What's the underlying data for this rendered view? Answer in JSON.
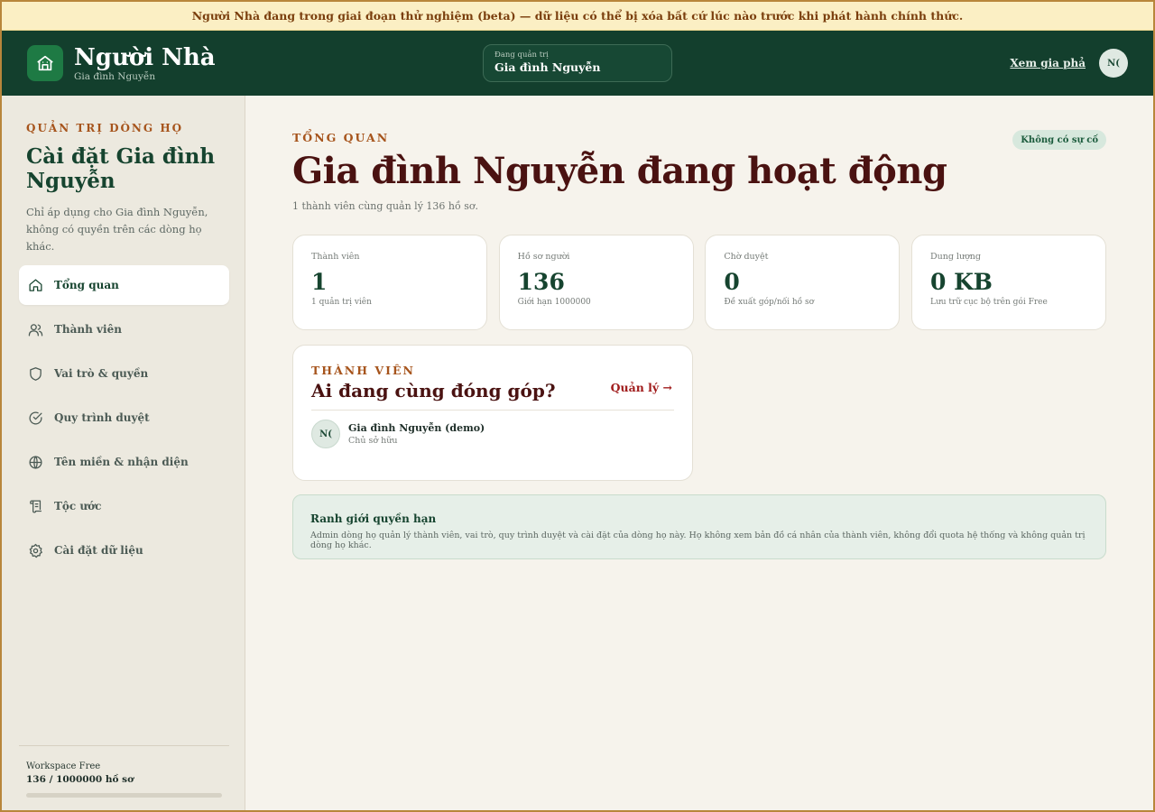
{
  "banner": "Người Nhà đang trong giai đoạn thử nghiệm (beta) — dữ liệu có thể bị xóa bất cứ lúc nào trước khi phát hành chính thức.",
  "header": {
    "brand": "Người Nhà",
    "brand_sub": "Gia đình Nguyễn",
    "workspace_label": "Đang quản trị",
    "workspace_value": "Gia đình Nguyễn",
    "view_tree_link": "Xem gia phả",
    "avatar_initials": "N("
  },
  "sidebar": {
    "eyebrow": "QUẢN TRỊ DÒNG HỌ",
    "title": "Cài đặt Gia đình Nguyễn",
    "description": "Chỉ áp dụng cho Gia đình Nguyễn, không có quyền trên các dòng họ khác.",
    "items": [
      {
        "label": "Tổng quan",
        "icon": "home-icon"
      },
      {
        "label": "Thành viên",
        "icon": "users-icon"
      },
      {
        "label": "Vai trò & quyền",
        "icon": "shield-icon"
      },
      {
        "label": "Quy trình duyệt",
        "icon": "check-circle-icon"
      },
      {
        "label": "Tên miền & nhận diện",
        "icon": "globe-icon"
      },
      {
        "label": "Tộc ước",
        "icon": "scroll-icon"
      },
      {
        "label": "Cài đặt dữ liệu",
        "icon": "gear-icon"
      }
    ],
    "footer": {
      "plan": "Workspace Free",
      "usage": "136 / 1000000 hồ sơ",
      "usage_fraction": 0.000136
    }
  },
  "main": {
    "eyebrow": "TỔNG QUAN",
    "status_badge": "Không có sự cố",
    "title": "Gia đình Nguyễn đang hoạt động",
    "subtitle": "1 thành viên cùng quản lý 136 hồ sơ.",
    "stats": [
      {
        "label": "Thành viên",
        "value": "1",
        "note": "1 quản trị viên"
      },
      {
        "label": "Hồ sơ người",
        "value": "136",
        "note": "Giới hạn 1000000"
      },
      {
        "label": "Chờ duyệt",
        "value": "0",
        "note": "Đề xuất góp/nối hồ sơ"
      },
      {
        "label": "Dung lượng",
        "value": "0 KB",
        "note": "Lưu trữ cục bộ trên gói Free"
      }
    ],
    "members": {
      "eyebrow": "THÀNH VIÊN",
      "title": "Ai đang cùng đóng góp?",
      "manage_link": "Quản lý →",
      "list": [
        {
          "initials": "N(",
          "name": "Gia đình Nguyễn (demo)",
          "role": "Chủ sở hữu"
        }
      ]
    },
    "note": {
      "title": "Ranh giới quyền hạn",
      "body": "Admin dòng họ quản lý thành viên, vai trò, quy trình duyệt và cài đặt của dòng họ này. Họ không xem bản đồ cá nhân của thành viên, không đổi quota hệ thống và không quản trị dòng họ khác."
    }
  },
  "colors": {
    "header_bg": "#133f2d",
    "accent_brown": "#a6541c",
    "title_maroon": "#4a1211",
    "brand_green": "#1e7a44"
  }
}
